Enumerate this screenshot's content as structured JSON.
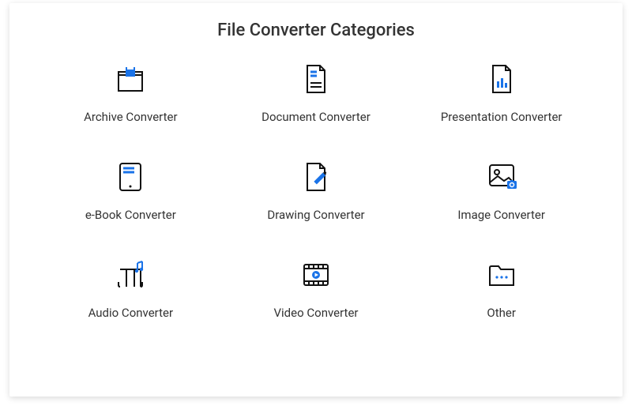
{
  "title": "File Converter Categories",
  "categories": [
    {
      "label": "Archive Converter",
      "icon": "archive-icon"
    },
    {
      "label": "Document Converter",
      "icon": "document-icon"
    },
    {
      "label": "Presentation Converter",
      "icon": "presentation-icon"
    },
    {
      "label": "e-Book Converter",
      "icon": "ebook-icon"
    },
    {
      "label": "Drawing Converter",
      "icon": "drawing-icon"
    },
    {
      "label": "Image Converter",
      "icon": "image-icon"
    },
    {
      "label": "Audio Converter",
      "icon": "audio-icon"
    },
    {
      "label": "Video Converter",
      "icon": "video-icon"
    },
    {
      "label": "Other",
      "icon": "other-icon"
    }
  ],
  "colors": {
    "accent": "#1a73e8",
    "outline": "#111"
  }
}
